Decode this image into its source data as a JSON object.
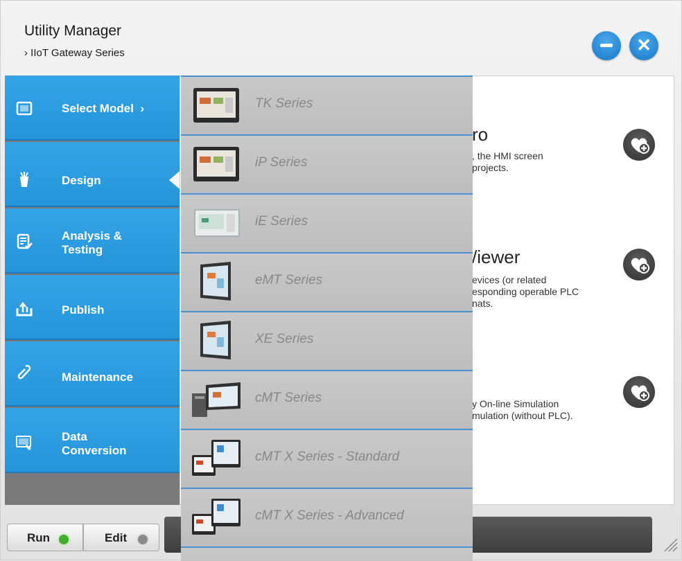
{
  "window": {
    "title": "Utility Manager",
    "breadcrumb": "› IIoT Gateway Series",
    "minimize_icon": "minus-icon",
    "close_icon": "close-icon"
  },
  "sidebar": {
    "items": [
      {
        "label": "Select Model  ›",
        "icon": "screen-icon"
      },
      {
        "label": "Design",
        "icon": "design-tools-icon"
      },
      {
        "label": "Analysis &\nTesting",
        "icon": "checklist-icon"
      },
      {
        "label": "Publish",
        "icon": "upload-icon"
      },
      {
        "label": "Maintenance",
        "icon": "link-icon"
      },
      {
        "label": "Data\nConversion",
        "icon": "convert-icon"
      }
    ]
  },
  "content": {
    "features": [
      {
        "title": "ro",
        "desc": ", the HMI screen\n projects."
      },
      {
        "title": "/iewer",
        "desc": "evices (or related\nesponding operable PLC\nnats."
      },
      {
        "title": "",
        "desc": "y On-line Simulation\nmulation (without PLC)."
      }
    ],
    "add_icon": "heart-plus-icon"
  },
  "model_menu": {
    "items": [
      {
        "label": "TK Series"
      },
      {
        "label": "iP Series"
      },
      {
        "label": "iE Series"
      },
      {
        "label": "eMT Series"
      },
      {
        "label": "XE Series"
      },
      {
        "label": "cMT Series"
      },
      {
        "label": "cMT X Series - Standard"
      },
      {
        "label": "cMT X Series - Advanced"
      }
    ]
  },
  "bottom": {
    "run_label": "Run",
    "edit_label": "Edit",
    "run_led_color": "#3fae2a",
    "edit_led_color": "#8a8a8a"
  },
  "colors": {
    "accent": "#2a9de2",
    "menu_divider": "#4a8fd0"
  }
}
